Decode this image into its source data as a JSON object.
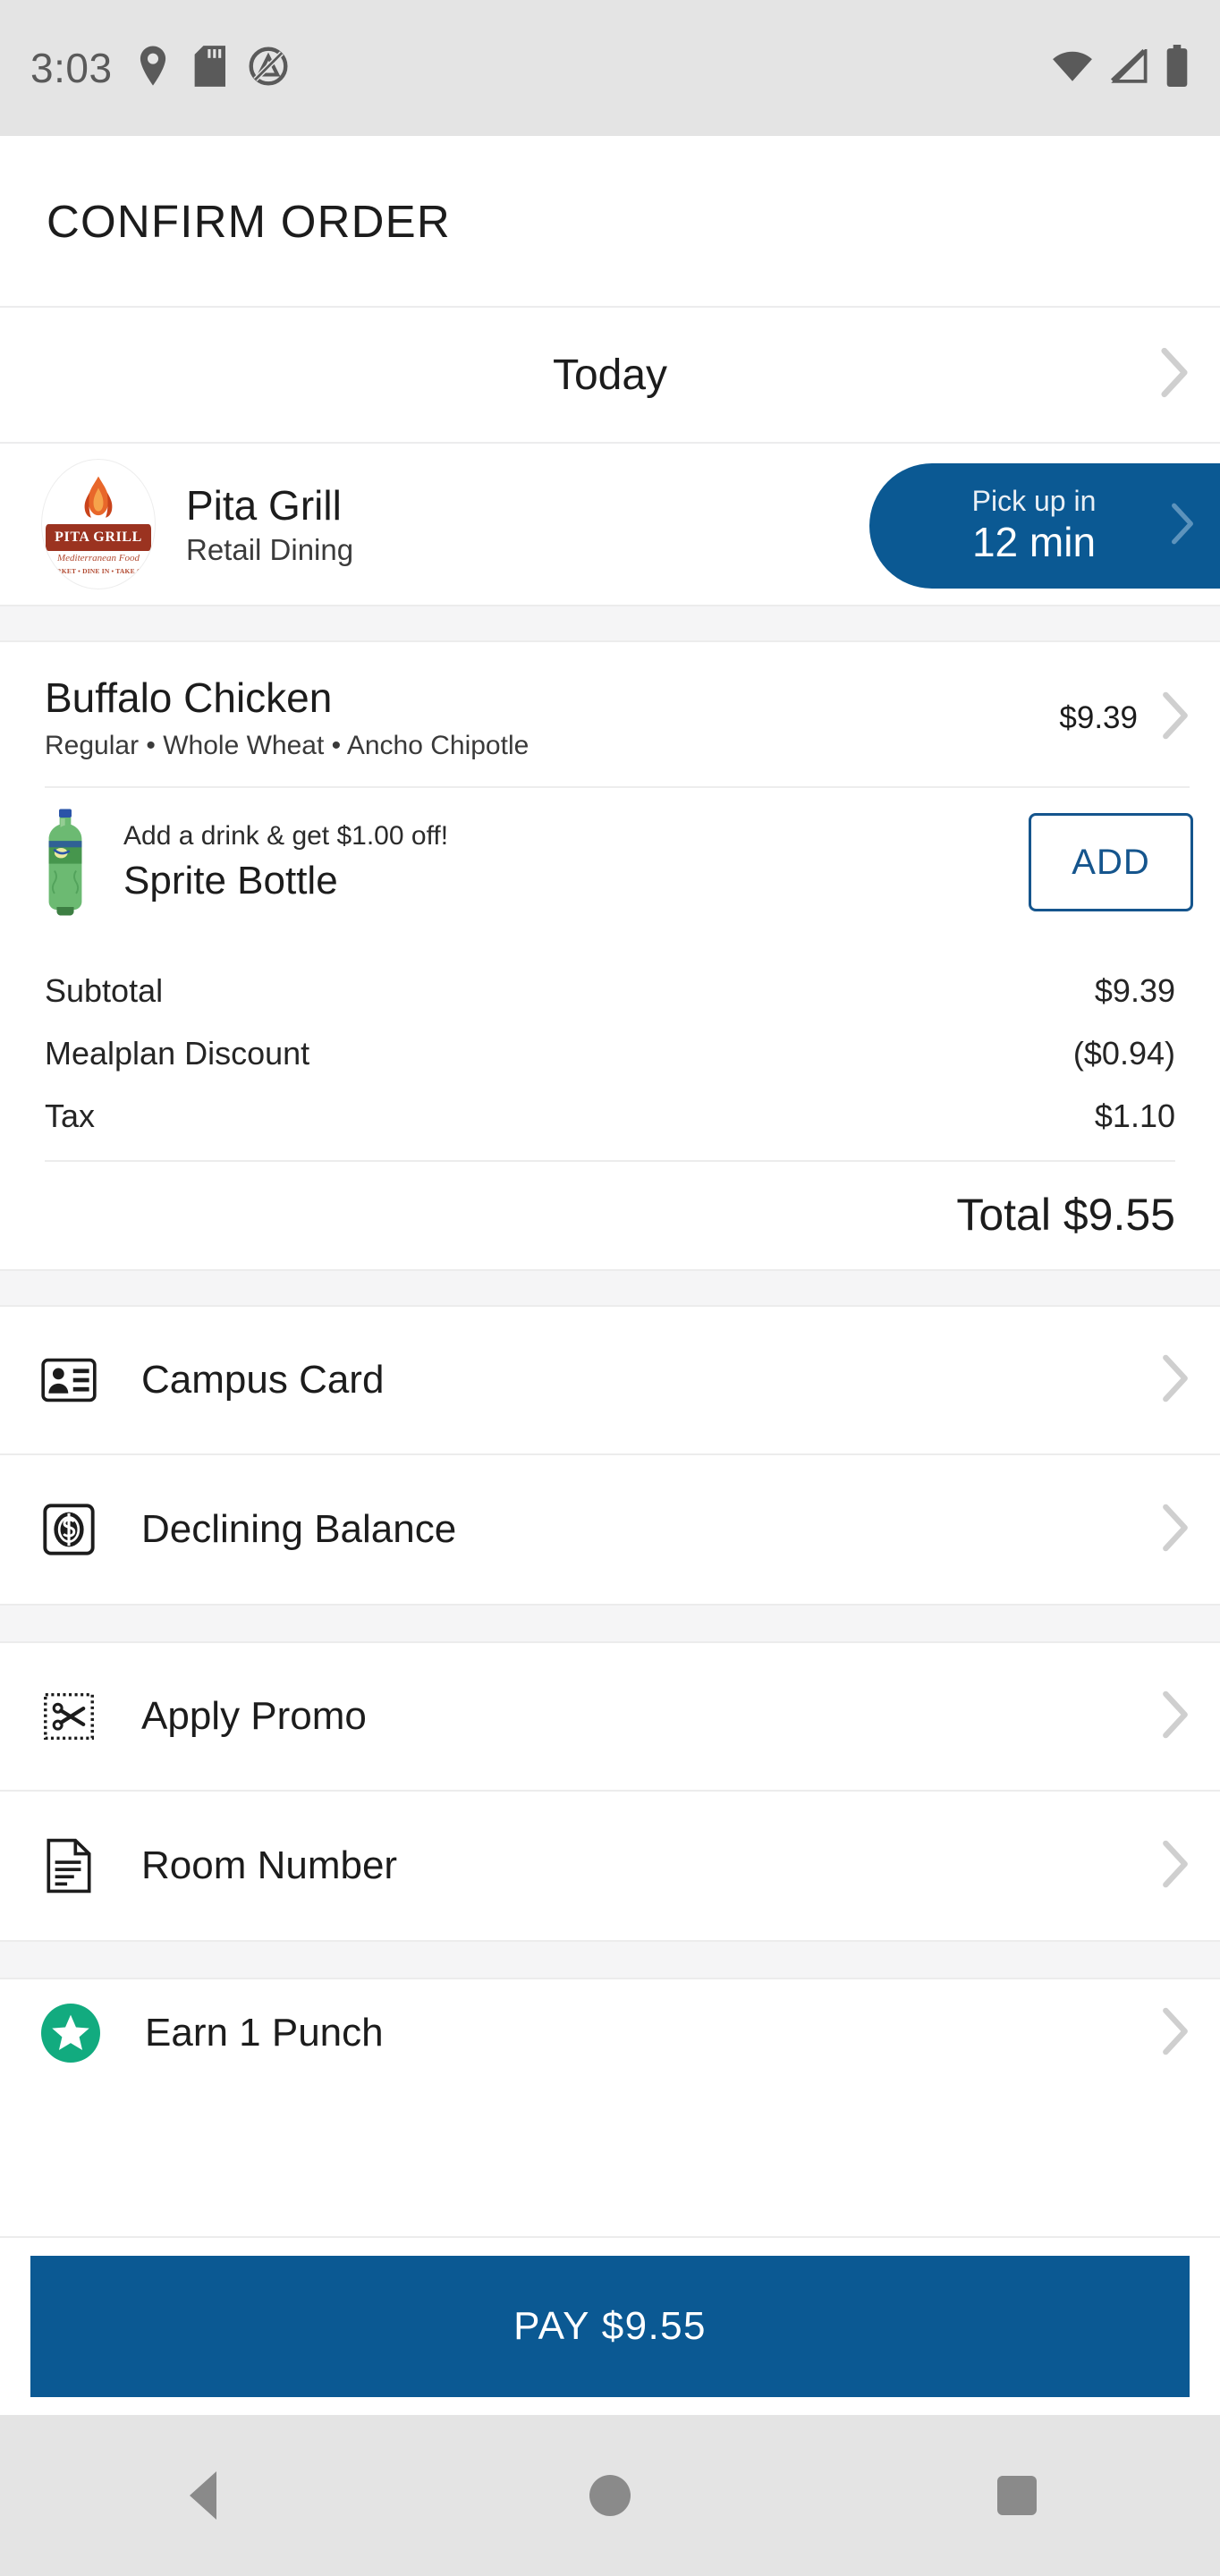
{
  "status_bar": {
    "time": "3:03",
    "left_icons": [
      "location-pin-icon",
      "sd-card-icon",
      "do-not-disturb-icon"
    ],
    "right_icons": [
      "wifi-icon",
      "cellular-signal-icon",
      "battery-icon"
    ]
  },
  "app_bar": {
    "title": "CONFIRM ORDER"
  },
  "schedule": {
    "label": "Today"
  },
  "venue": {
    "name": "Pita Grill",
    "category": "Retail Dining",
    "logo": {
      "banner_text": "PITA GRILL",
      "tagline": "Mediterranean Food",
      "services": "MARKET • DINE IN • TAKE OUT",
      "banner_color": "#9b3320",
      "flame_color": "#e8672a"
    },
    "pickup": {
      "prefix": "Pick up in",
      "time": "12 min",
      "color": "#0b5993"
    }
  },
  "order": {
    "item": {
      "name": "Buffalo Chicken",
      "options": "Regular • Whole Wheat • Ancho Chipotle",
      "price": "$9.39"
    },
    "upsell": {
      "promo": "Add a drink & get $1.00 off!",
      "name": "Sprite Bottle",
      "add_label": "ADD",
      "accent_color": "#15558d"
    }
  },
  "totals": {
    "lines": [
      {
        "label": "Subtotal",
        "value": "$9.39"
      },
      {
        "label": "Mealplan Discount",
        "value": "($0.94)"
      },
      {
        "label": "Tax",
        "value": "$1.10"
      }
    ],
    "grand_total": "Total $9.55"
  },
  "payment_options": [
    {
      "label": "Campus Card",
      "icon": "id-card-icon"
    },
    {
      "label": "Declining Balance",
      "icon": "dollar-badge-icon"
    }
  ],
  "extra_options": [
    {
      "label": "Apply Promo",
      "icon": "coupon-scissors-icon"
    },
    {
      "label": "Room Number",
      "icon": "document-icon"
    }
  ],
  "rewards": {
    "label": "Earn 1 Punch",
    "icon": "star-badge-icon",
    "color": "#12ab7f"
  },
  "pay_bar": {
    "label": "PAY $9.55",
    "color": "#0b5993"
  },
  "nav_bar": {
    "back": "back-button",
    "home": "home-button",
    "recents": "recents-button"
  }
}
